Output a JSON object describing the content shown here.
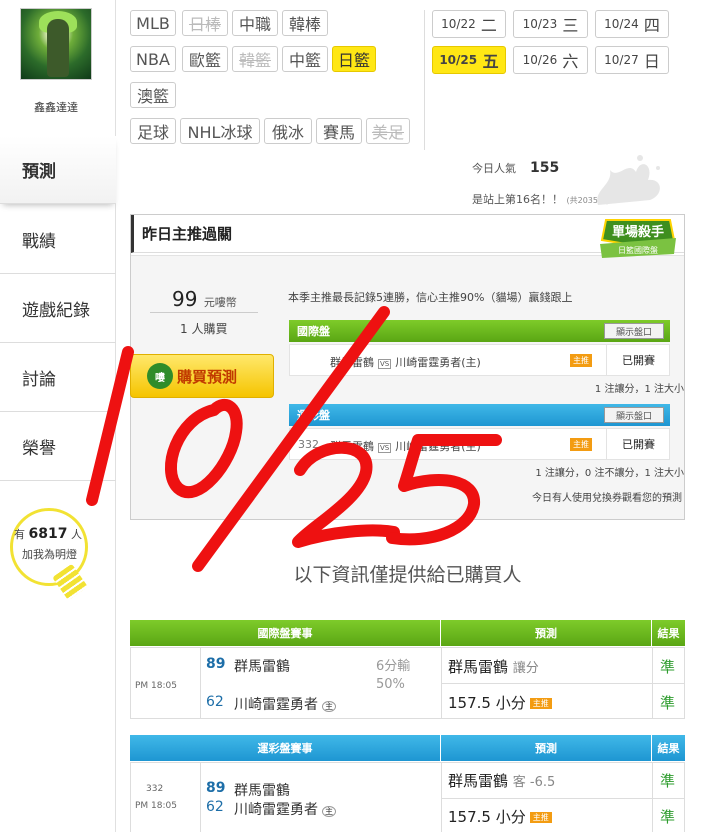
{
  "sidebar": {
    "username": "鑫鑫達達",
    "items": [
      {
        "label": "預測",
        "active": true
      },
      {
        "label": "戰績"
      },
      {
        "label": "遊戲紀錄"
      },
      {
        "label": "討論"
      },
      {
        "label": "榮譽"
      }
    ],
    "bulb": {
      "prefix": "有",
      "count": "6817",
      "suffix": "人",
      "text": "加我為明燈"
    }
  },
  "leagues": [
    {
      "label": "MLB"
    },
    {
      "label": "日棒",
      "disabled": true
    },
    {
      "label": "中職"
    },
    {
      "label": "韓棒"
    },
    {
      "label": "NBA"
    },
    {
      "label": "歐籃"
    },
    {
      "label": "韓籃",
      "disabled": true
    },
    {
      "label": "中籃"
    },
    {
      "label": "日籃",
      "selected": true
    },
    {
      "label": "澳籃"
    },
    {
      "label": "足球"
    },
    {
      "label": "NHL冰球"
    },
    {
      "label": "俄冰"
    },
    {
      "label": "賽馬"
    },
    {
      "label": "美足",
      "disabled": true
    }
  ],
  "dates": [
    {
      "md": "10/22",
      "day": "二"
    },
    {
      "md": "10/23",
      "day": "三"
    },
    {
      "md": "10/24",
      "day": "四"
    },
    {
      "md": "10/25",
      "day": "五",
      "selected": true
    },
    {
      "md": "10/26",
      "day": "六"
    },
    {
      "md": "10/27",
      "day": "日"
    }
  ],
  "stats": {
    "popularity_label": "今日人氣",
    "popularity_value": "155",
    "rank_text": "是站上第16名！！",
    "rank_sub": "(共2035人)"
  },
  "pass": {
    "title": "昨日主推過關",
    "badge_line1": "單場殺手",
    "badge_line2": "日籃國際盤",
    "price": "99",
    "price_unit": "元嘍幣",
    "buyers": "1 人購買",
    "buy_label": "購買預測",
    "coin_label": "嘍",
    "note": "本季主推最長記錄5連勝，信心主推90%（貓場）贏錢跟上",
    "sections": [
      {
        "title": "國際盤",
        "button": "顯示盤口",
        "num": "",
        "home": "群馬雷鶴",
        "vs": "VS",
        "away": "川崎雷霆勇者(主)",
        "tag": "主推",
        "status": "已開賽",
        "summary": "1 注讓分，1 注大小"
      },
      {
        "title": "運彩盤",
        "button": "顯示盤口",
        "num": "332",
        "home": "群馬雷鶴",
        "vs": "VS",
        "away": "川崎雷霆勇者(主)",
        "tag": "主推",
        "status": "已開賽",
        "summary": "1 注讓分，0 注不讓分，1 注大小"
      }
    ],
    "today_note": "今日有人使用兌換券觀看您的預測"
  },
  "info_line": "以下資訊僅提供給已購買人",
  "tables": [
    {
      "header_game": "國際盤賽事",
      "header_pick": "預測",
      "header_result": "結果",
      "num": "",
      "time": "PM 18:05",
      "team1_num": "89",
      "team1": "群馬雷鶴",
      "team2_num": "62",
      "team2": "川崎雷霆勇者",
      "home_mark": "主",
      "odds_line1": "6分輸",
      "odds_line2": "50%",
      "pick1": "群馬雷鶴",
      "pick1_note": "讓分",
      "result1": "準",
      "pick2": "157.5 小分",
      "pick2_tag": "主推",
      "result2": "準"
    },
    {
      "header_game": "運彩盤賽事",
      "header_pick": "預測",
      "header_result": "結果",
      "num": "332",
      "time": "PM 18:05",
      "team1_num": "89",
      "team1": "群馬雷鶴",
      "team2_num": "62",
      "team2": "川崎雷霆勇者",
      "home_mark": "主",
      "pick1": "群馬雷鶴",
      "pick1_note": "客 -6.5",
      "result1": "準",
      "pick2": "157.5 小分",
      "pick2_tag": "主推",
      "result2": "準"
    }
  ],
  "handwriting": "10/25",
  "colors": {
    "accent_yellow": "#ffe714",
    "green_bar": "#6bb820",
    "blue_bar": "#2aa6dc",
    "scribble_red": "#ee1111"
  }
}
